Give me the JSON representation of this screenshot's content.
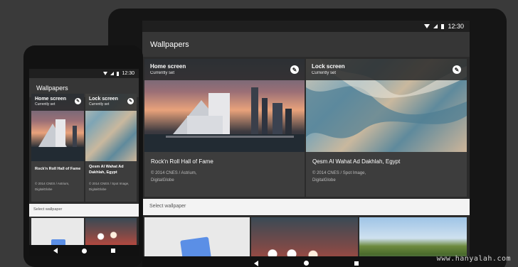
{
  "status_time": "12:30",
  "app_title": "Wallpapers",
  "home_card": {
    "label": "Home screen",
    "sub": "Currently set",
    "caption": "Rock'n Roll Hall of Fame",
    "credit_1": "© 2014 CNES / Astrium,",
    "credit_2": "DigitalGlobe"
  },
  "lock_card": {
    "label": "Lock screen",
    "sub": "Currently set",
    "caption": "Qesm Al Wahat Ad Dakhlah, Egypt",
    "phone_caption_1": "Qesm Al Wahat Ad",
    "phone_caption_2": "Dakhlah, Egypt",
    "credit_1": "© 2014 CNES / Spot Image,",
    "credit_2": "DigitalGlobe"
  },
  "select_label": "Select wallpaper",
  "icons": {
    "edit": "pencil-icon",
    "wifi": "wifi-icon",
    "signal": "signal-icon",
    "battery": "battery-icon",
    "back": "back-icon",
    "home": "home-icon",
    "recents": "recents-icon",
    "gallery": "gallery-icon"
  },
  "watermark": "www.hanyalah.com",
  "colors": {
    "background": "#3a3a3a",
    "app_bar": "#363636",
    "card": "#3d3d3d",
    "select_bar": "#f3f3f3",
    "gallery_tile": "#e9e9e9",
    "gallery_icon": "#5b8fe6"
  }
}
